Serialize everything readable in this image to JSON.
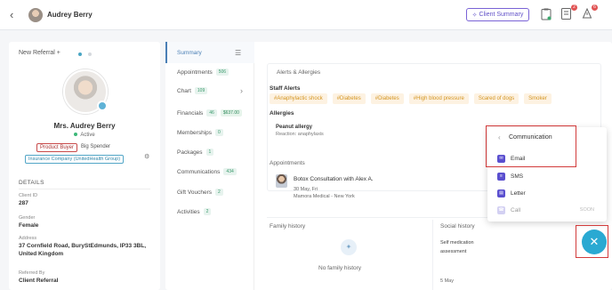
{
  "header": {
    "back_icon": "chevron-left-icon",
    "patient_name": "Audrey Berry",
    "client_summary_label": "Client Summary",
    "badges": {
      "notes": "2",
      "alerts": "6"
    }
  },
  "profile": {
    "new_referral_label": "New Referral +",
    "full_name": "Mrs. Audrey Berry",
    "status": "Active",
    "tags": [
      "Product Buyer",
      "Big Spender"
    ],
    "insurance": "Insurance Company (UnitedHealth Group)",
    "details_heading": "DETAILS",
    "fields": [
      {
        "label": "Client ID",
        "value": "287"
      },
      {
        "label": "Gender",
        "value": "Female"
      },
      {
        "label": "Address",
        "value": "37 Cornfield Road, BuryStEdmunds, IP33 3BL, United Kingdom"
      },
      {
        "label": "Referred By",
        "value": "Client Referral"
      }
    ]
  },
  "nav": {
    "items": [
      {
        "label": "Summary",
        "count": ""
      },
      {
        "label": "Appointments",
        "count": "506"
      },
      {
        "label": "Chart",
        "count": "109"
      },
      {
        "label": "Financials",
        "count": "46",
        "price": "$637.00"
      },
      {
        "label": "Memberships",
        "count": "0"
      },
      {
        "label": "Packages",
        "count": "1"
      },
      {
        "label": "Communications",
        "count": "434"
      },
      {
        "label": "Gift Vouchers",
        "count": "2"
      },
      {
        "label": "Activities",
        "count": "2"
      }
    ]
  },
  "alerts": {
    "title": "Alerts & Allergies",
    "staff_alerts_label": "Staff Alerts",
    "staff_alerts": [
      "#Anaphylactic shock",
      "#Diabetes",
      "#Diabetes",
      "#High blood pressure",
      "Scared of dogs",
      "Smoker"
    ],
    "allergies_label": "Allergies",
    "allergy_name": "Peanut allergy",
    "allergy_reaction": "Reaction: anaphylaxis"
  },
  "appointments": {
    "title": "Appointments",
    "item_title": "Botox Consultation with Alex A.",
    "item_date": "30 May, Fri",
    "item_location": "Mamora Medical - New York"
  },
  "family_history": {
    "title": "Family history",
    "empty_text": "No family history"
  },
  "social_history": {
    "title": "Social history",
    "entry": "Self medication assessment",
    "date": "5 May"
  },
  "communication_popup": {
    "title": "Communication",
    "items": [
      {
        "label": "Email",
        "icon": "email-icon"
      },
      {
        "label": "SMS",
        "icon": "sms-icon"
      },
      {
        "label": "Letter",
        "icon": "letter-icon"
      },
      {
        "label": "Call",
        "icon": "call-icon",
        "note": "SOON"
      }
    ]
  },
  "fab_icon": "close-icon"
}
